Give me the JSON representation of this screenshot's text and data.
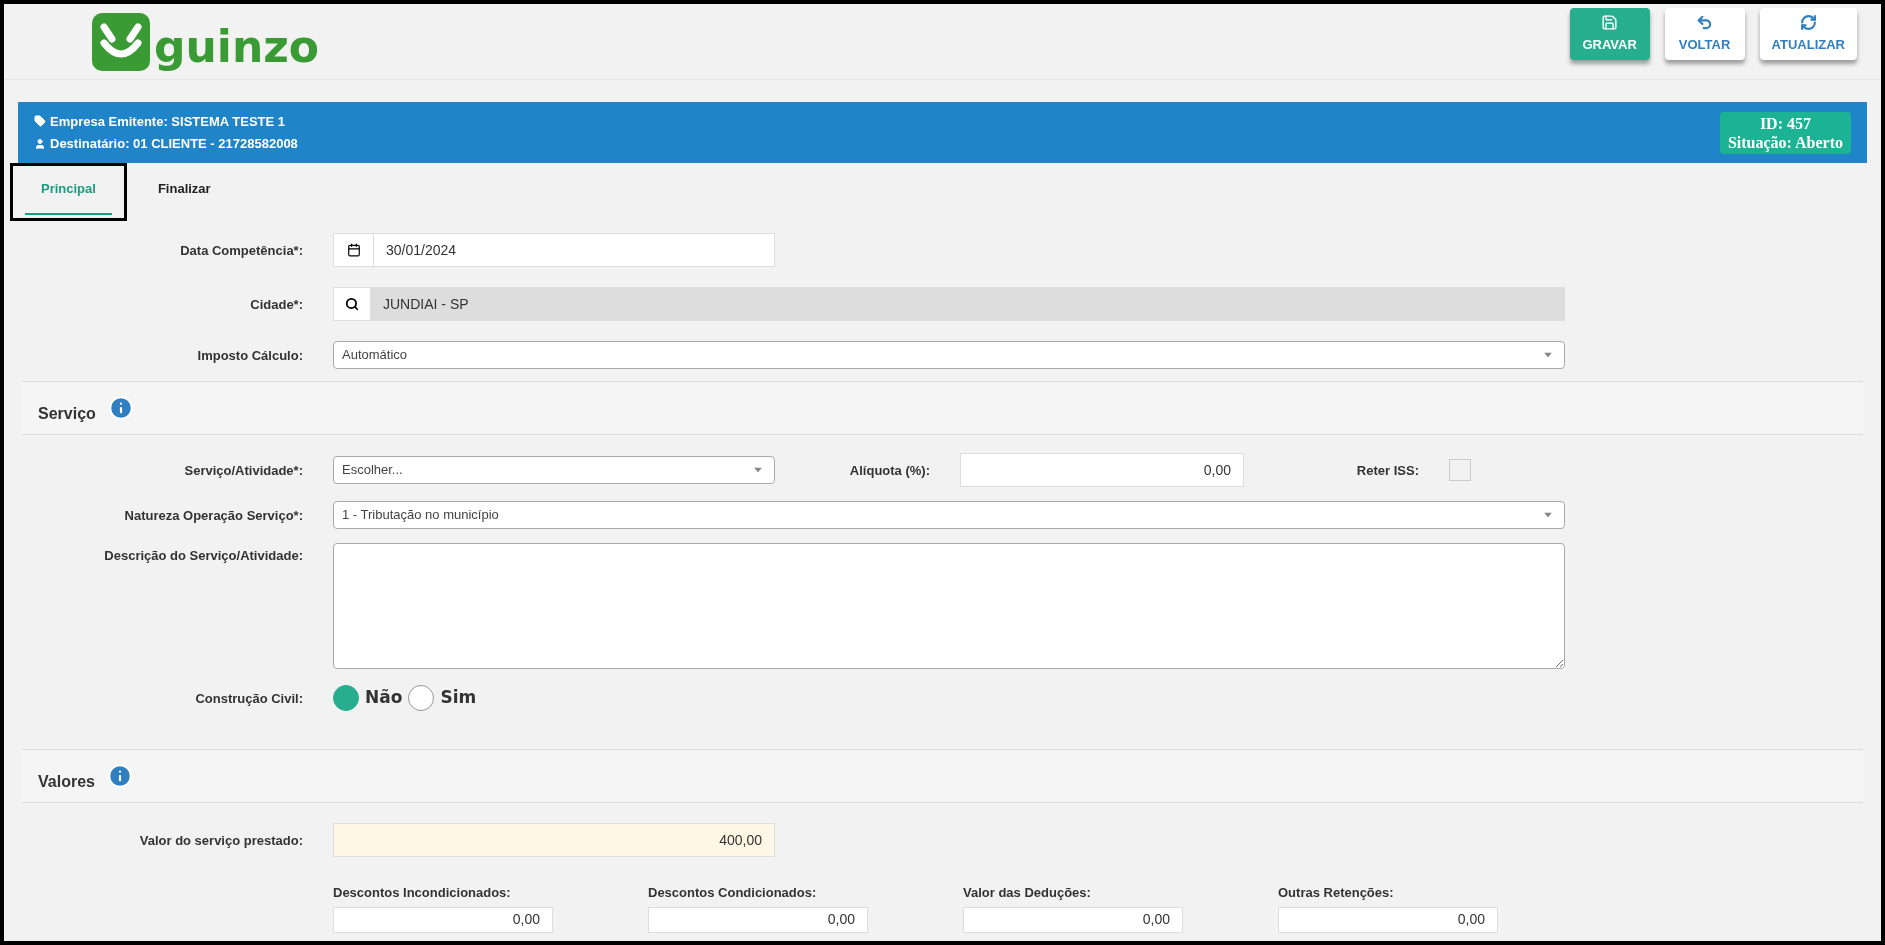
{
  "logo": {
    "text": "guinzo"
  },
  "toolbar": [
    {
      "kind": "save",
      "label": "GRAVAR"
    },
    {
      "kind": "back",
      "label": "VOLTAR"
    },
    {
      "kind": "refresh",
      "label": "ATUALIZAR"
    }
  ],
  "header": {
    "issuer": "Empresa Emitente: SISTEMA TESTE 1",
    "recipient": "Destinatário: 01 CLIENTE - 21728582008",
    "id": "ID: 457",
    "status": "Situação: Aberto"
  },
  "tabs": [
    {
      "label": "Principal",
      "selected": true
    },
    {
      "label": "Finalizar",
      "selected": false
    }
  ],
  "main": {
    "date": {
      "label": "Data Competência*:",
      "value": "30/01/2024"
    },
    "city": {
      "label": "Cidade*:",
      "value": "JUNDIAI - SP"
    },
    "tax_calc": {
      "label": "Imposto Cálculo:",
      "value": "Automático"
    }
  },
  "service": {
    "title": "Serviço",
    "activity": {
      "label": "Serviço/Atividade*:",
      "placeholder": "Escolher..."
    },
    "rate": {
      "label": "Alíquota (%):",
      "value": "0,00"
    },
    "withhold_iss": {
      "label": "Reter ISS:",
      "checked": false
    },
    "nature": {
      "label": "Natureza Operação Serviço*:",
      "value": "1 - Tributação no município"
    },
    "description": {
      "label": "Descrição do Serviço/Atividade:"
    },
    "construction": {
      "label": "Construção Civil:",
      "options": [
        {
          "label": "Não",
          "selected": true
        },
        {
          "label": "Sim",
          "selected": false
        }
      ]
    }
  },
  "values": {
    "title": "Valores",
    "service_value": {
      "label": "Valor do serviço prestado:",
      "value": "400,00"
    },
    "fields": [
      {
        "label": "Descontos Incondicionados:",
        "value": "0,00"
      },
      {
        "label": "Descontos Condicionados:",
        "value": "0,00"
      },
      {
        "label": "Valor das Deduções:",
        "value": "0,00"
      },
      {
        "label": "Outras Retenções:",
        "value": "0,00"
      }
    ]
  }
}
